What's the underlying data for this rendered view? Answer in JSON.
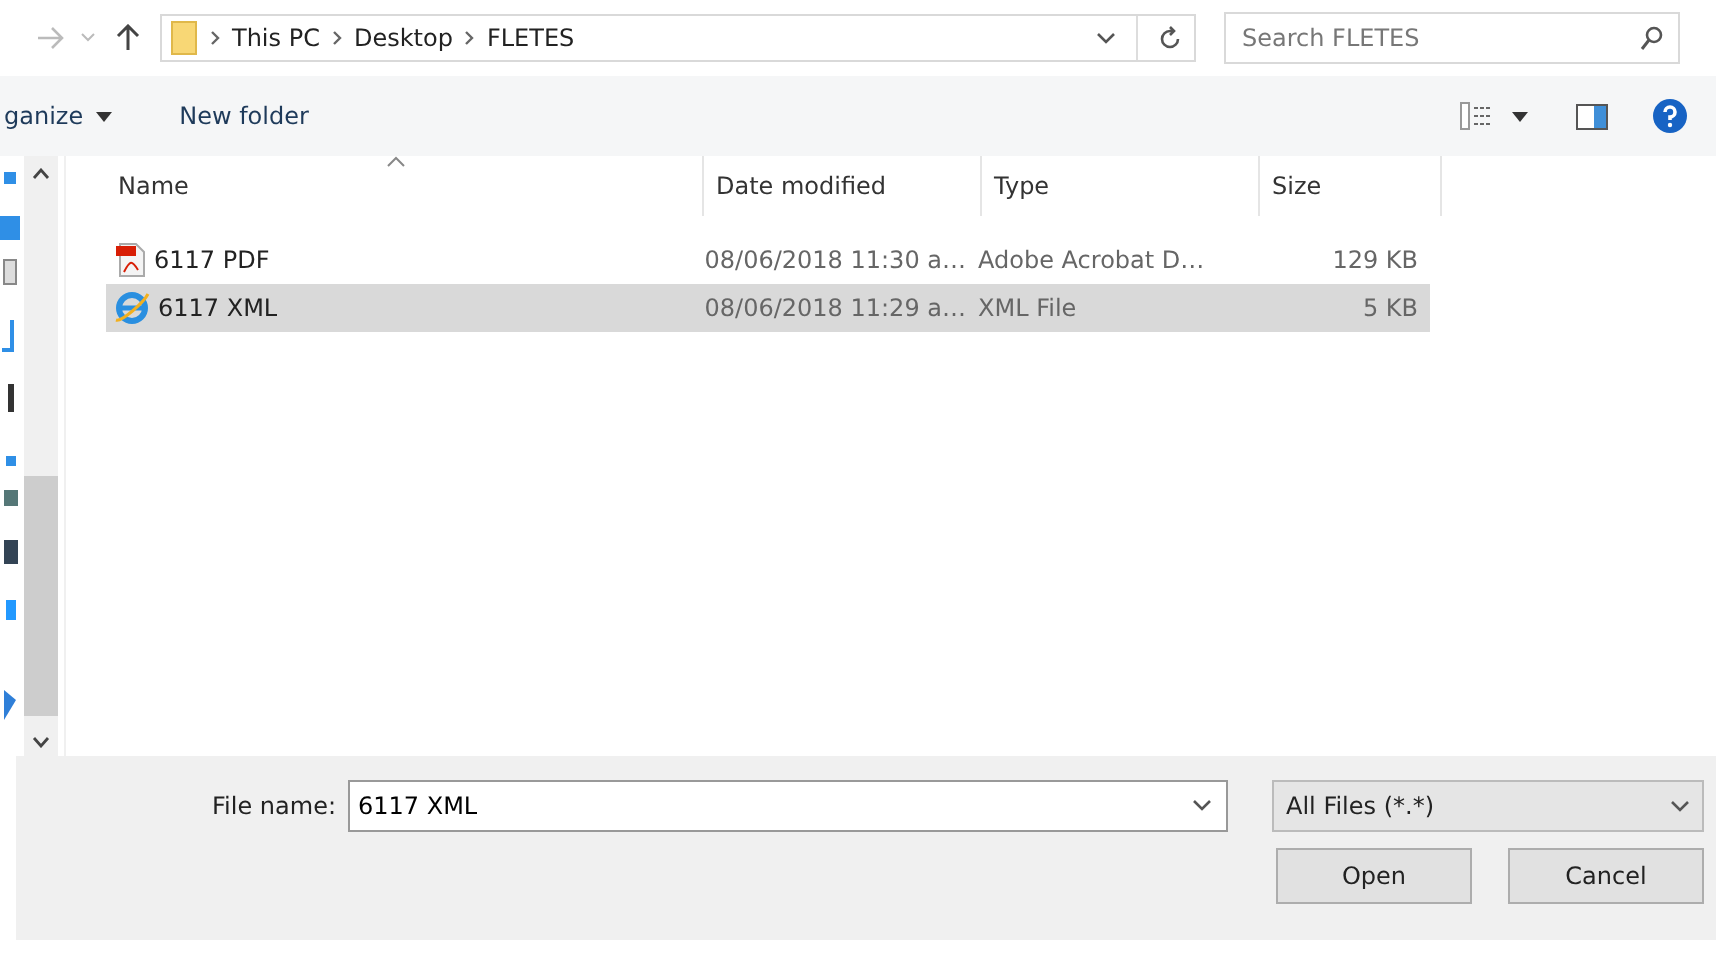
{
  "address_bar": {
    "path": [
      "This PC",
      "Desktop",
      "FLETES"
    ]
  },
  "search": {
    "placeholder": "Search FLETES"
  },
  "toolbar": {
    "organize": "ganize",
    "new_folder": "New folder"
  },
  "table": {
    "columns": [
      "Name",
      "Date modified",
      "Type",
      "Size"
    ],
    "rows": [
      {
        "kind": "pdf",
        "name": "6117 PDF",
        "date": "08/06/2018 11:30 a…",
        "type": "Adobe Acrobat D…",
        "size": "129 KB",
        "selected": false
      },
      {
        "kind": "web",
        "name": "6117 XML",
        "date": "08/06/2018 11:29 a…",
        "type": "XML File",
        "size": "5 KB",
        "selected": true
      }
    ]
  },
  "file_name": {
    "label": "File name:",
    "value": "6117 XML"
  },
  "file_type": {
    "value": "All Files (*.*)"
  },
  "buttons": [
    "Open",
    "Cancel"
  ]
}
